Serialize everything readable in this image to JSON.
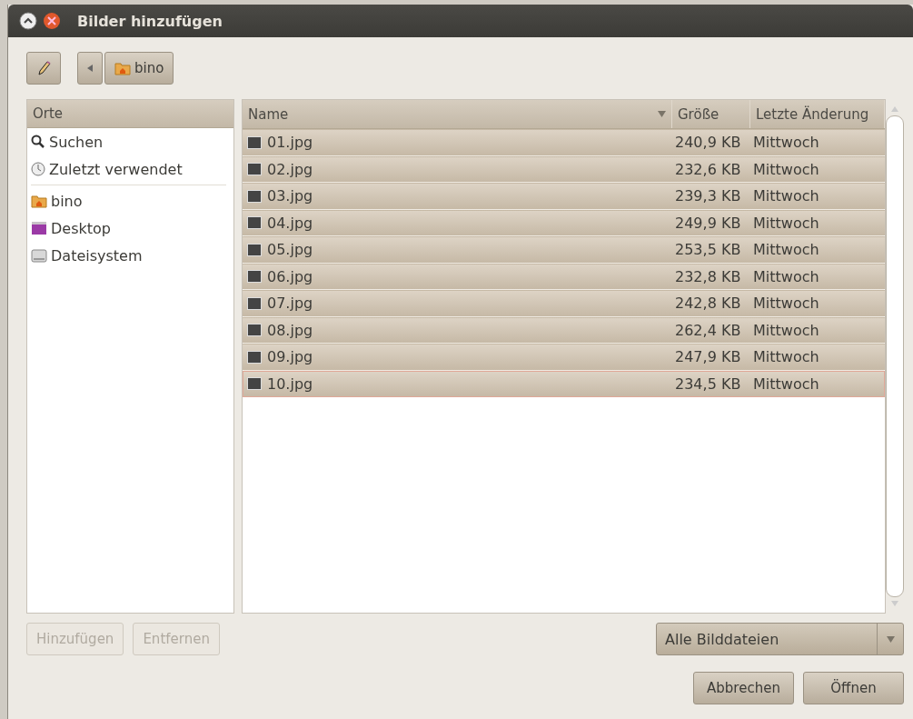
{
  "window": {
    "title": "Bilder hinzufügen"
  },
  "path_bar": {
    "current": "bino"
  },
  "places": {
    "header": "Orte",
    "groups": [
      [
        {
          "kind": "search",
          "label": "Suchen"
        },
        {
          "kind": "recent",
          "label": "Zuletzt verwendet"
        }
      ],
      [
        {
          "kind": "home",
          "label": "bino"
        },
        {
          "kind": "desktop",
          "label": "Desktop"
        },
        {
          "kind": "drive",
          "label": "Dateisystem"
        }
      ]
    ]
  },
  "table": {
    "columns": [
      "Name",
      "Größe",
      "Letzte Änderung"
    ],
    "rows": [
      {
        "name": "01.jpg",
        "size": "240,9 KB",
        "modified": "Mittwoch",
        "selected": true,
        "focused": false
      },
      {
        "name": "02.jpg",
        "size": "232,6 KB",
        "modified": "Mittwoch",
        "selected": true,
        "focused": false
      },
      {
        "name": "03.jpg",
        "size": "239,3 KB",
        "modified": "Mittwoch",
        "selected": true,
        "focused": false
      },
      {
        "name": "04.jpg",
        "size": "249,9 KB",
        "modified": "Mittwoch",
        "selected": true,
        "focused": false
      },
      {
        "name": "05.jpg",
        "size": "253,5 KB",
        "modified": "Mittwoch",
        "selected": true,
        "focused": false
      },
      {
        "name": "06.jpg",
        "size": "232,8 KB",
        "modified": "Mittwoch",
        "selected": true,
        "focused": false
      },
      {
        "name": "07.jpg",
        "size": "242,8 KB",
        "modified": "Mittwoch",
        "selected": true,
        "focused": false
      },
      {
        "name": "08.jpg",
        "size": "262,4 KB",
        "modified": "Mittwoch",
        "selected": true,
        "focused": false
      },
      {
        "name": "09.jpg",
        "size": "247,9 KB",
        "modified": "Mittwoch",
        "selected": true,
        "focused": false
      },
      {
        "name": "10.jpg",
        "size": "234,5 KB",
        "modified": "Mittwoch",
        "selected": true,
        "focused": true
      }
    ]
  },
  "place_buttons": [
    {
      "label": "Hinzufügen",
      "disabled": true
    },
    {
      "label": "Entfernen",
      "disabled": true
    }
  ],
  "filter": {
    "value": "Alle Bilddateien"
  },
  "buttons": [
    {
      "label": "Abbrechen"
    },
    {
      "label": "Öffnen"
    }
  ]
}
